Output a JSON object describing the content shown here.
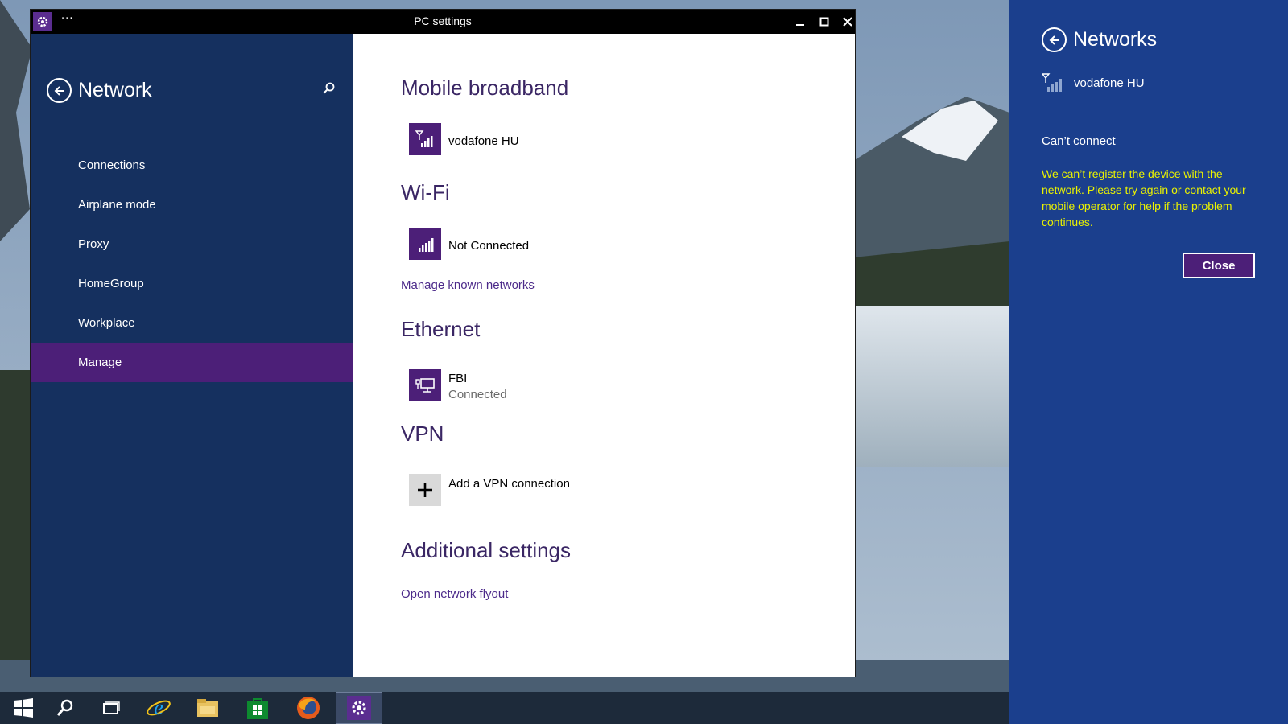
{
  "window": {
    "title": "PC settings",
    "menu_dots": "···"
  },
  "sidebar": {
    "heading": "Network",
    "items": [
      {
        "label": "Connections"
      },
      {
        "label": "Airplane mode"
      },
      {
        "label": "Proxy"
      },
      {
        "label": "HomeGroup"
      },
      {
        "label": "Workplace"
      },
      {
        "label": "Manage",
        "active": true
      }
    ]
  },
  "content": {
    "mobile_broadband": {
      "title": "Mobile broadband",
      "network_name": "vodafone HU"
    },
    "wifi": {
      "title": "Wi-Fi",
      "status": "Not Connected",
      "manage_link": "Manage known networks"
    },
    "ethernet": {
      "title": "Ethernet",
      "network_name": "FBI",
      "status": "Connected"
    },
    "vpn": {
      "title": "VPN",
      "add_label": "Add a VPN connection"
    },
    "additional": {
      "title": "Additional settings",
      "flyout_link": "Open network flyout"
    }
  },
  "flyout": {
    "heading": "Networks",
    "network_name": "vodafone HU",
    "status": "Can’t connect",
    "message": "We can’t register the device with the network. Please try again or contact your mobile operator for help if the problem continues.",
    "close_label": "Close"
  },
  "taskbar": {
    "items": [
      "start-icon",
      "search-icon",
      "task-view-icon",
      "internet-explorer-icon",
      "file-explorer-icon",
      "store-icon",
      "firefox-icon",
      "settings-icon"
    ],
    "active": "settings-icon"
  },
  "colors": {
    "sidebar_bg": "#15305f",
    "accent_purple": "#4c1f78",
    "flyout_bg": "#1b3f8d",
    "error_text": "#eaf200"
  }
}
